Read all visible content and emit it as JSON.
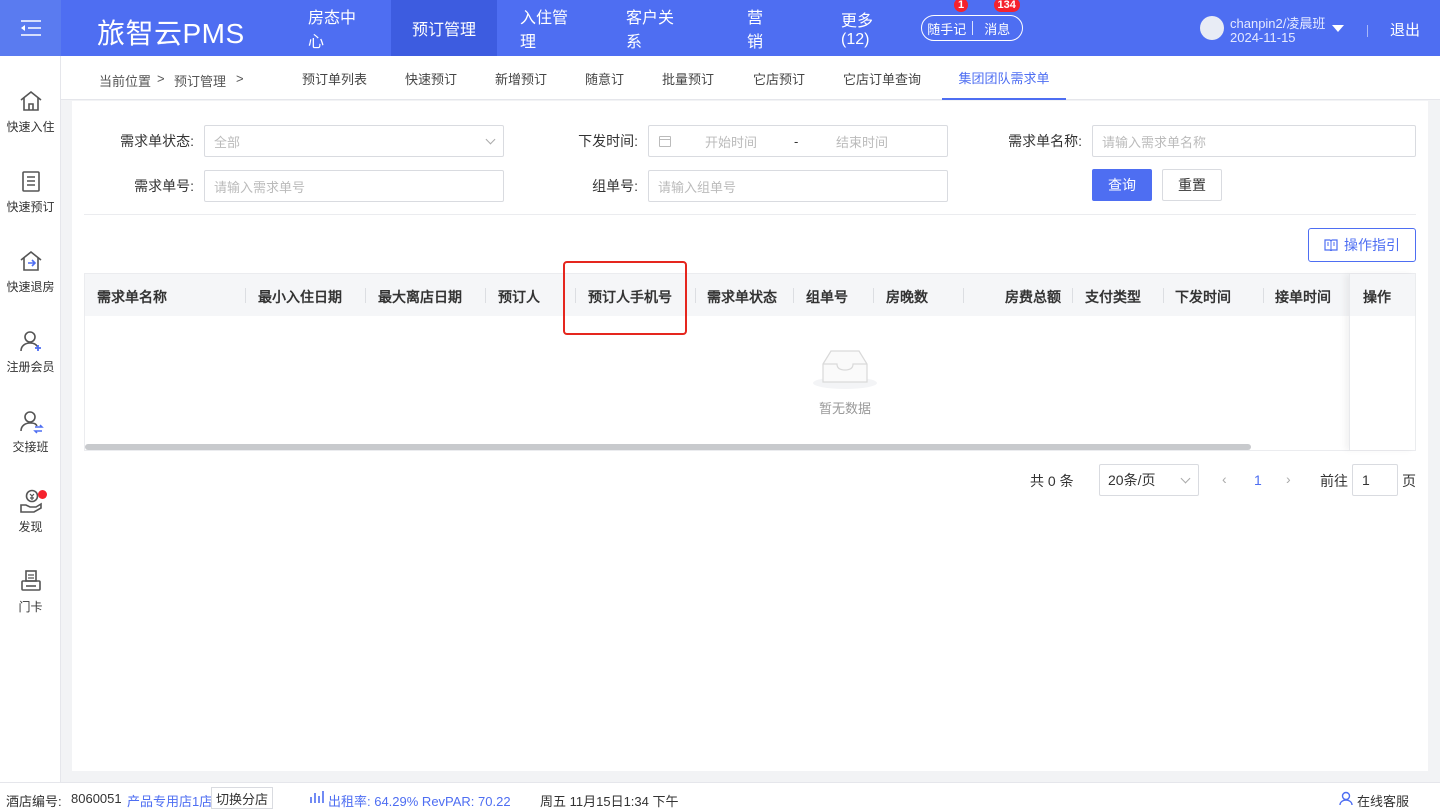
{
  "header": {
    "brand": "旅智云PMS",
    "nav": [
      "房态中心",
      "预订管理",
      "入住管理",
      "客户关系",
      "营销",
      "更多(12)"
    ],
    "active_nav": "预订管理",
    "notes_label": "随手记",
    "notes_badge": "1",
    "messages_label": "消息",
    "messages_badge": "134",
    "user_name": "chanpin2/凌晨班",
    "user_date": "2024-11-15",
    "logout": "退出",
    "accent_color": "#4e6ef2"
  },
  "sidebar": {
    "items": [
      {
        "label": "快速入住",
        "icon": "home-icon"
      },
      {
        "label": "快速预订",
        "icon": "list-doc-icon"
      },
      {
        "label": "快速退房",
        "icon": "house-exit-icon"
      },
      {
        "label": "注册会员",
        "icon": "user-plus-icon"
      },
      {
        "label": "交接班",
        "icon": "user-swap-icon"
      },
      {
        "label": "发现",
        "icon": "money-hand-icon"
      },
      {
        "label": "门卡",
        "icon": "card-printer-icon"
      }
    ]
  },
  "breadcrumb": {
    "prefix": "当前位置",
    "sep1": ">",
    "section": "预订管理",
    "sep2": ">"
  },
  "tabs": [
    "预订单列表",
    "快速预订",
    "新增预订",
    "随意订",
    "批量预订",
    "它店预订",
    "它店订单查询",
    "集团团队需求单"
  ],
  "active_tab": "集团团队需求单",
  "filters": {
    "status_label": "需求单状态:",
    "status_value": "全部",
    "issue_time_label": "下发时间:",
    "start_placeholder": "开始时间",
    "range_sep": "-",
    "end_placeholder": "结束时间",
    "name_label": "需求单名称:",
    "name_placeholder": "请输入需求单名称",
    "number_label": "需求单号:",
    "number_placeholder": "请输入需求单号",
    "group_label": "组单号:",
    "group_placeholder": "请输入组单号",
    "query": "查询",
    "reset": "重置"
  },
  "guide_button": "操作指引",
  "table": {
    "columns": [
      "需求单名称",
      "最小入住日期",
      "最大离店日期",
      "预订人",
      "预订人手机号",
      "需求单状态",
      "组单号",
      "房晚数",
      "房费总额",
      "支付类型",
      "下发时间",
      "接单时间"
    ],
    "action_column": "操作",
    "rows": [],
    "empty_text": "暂无数据"
  },
  "pagination": {
    "total": "共 0 条",
    "page_size": "20条/页",
    "prev": "‹",
    "current": "1",
    "next": "›",
    "goto_label": "前往",
    "goto_value": "1",
    "goto_suffix": "页"
  },
  "statusbar": {
    "hotel_label": "酒店编号:",
    "hotel_no": "8060051",
    "store_name": "产品专用店1店",
    "switch_store": "切换分店",
    "occupancy": "出租率: 64.29% RevPAR: 70.22",
    "datetime": "周五 11月15日1:34 下午",
    "support": "在线客服"
  }
}
